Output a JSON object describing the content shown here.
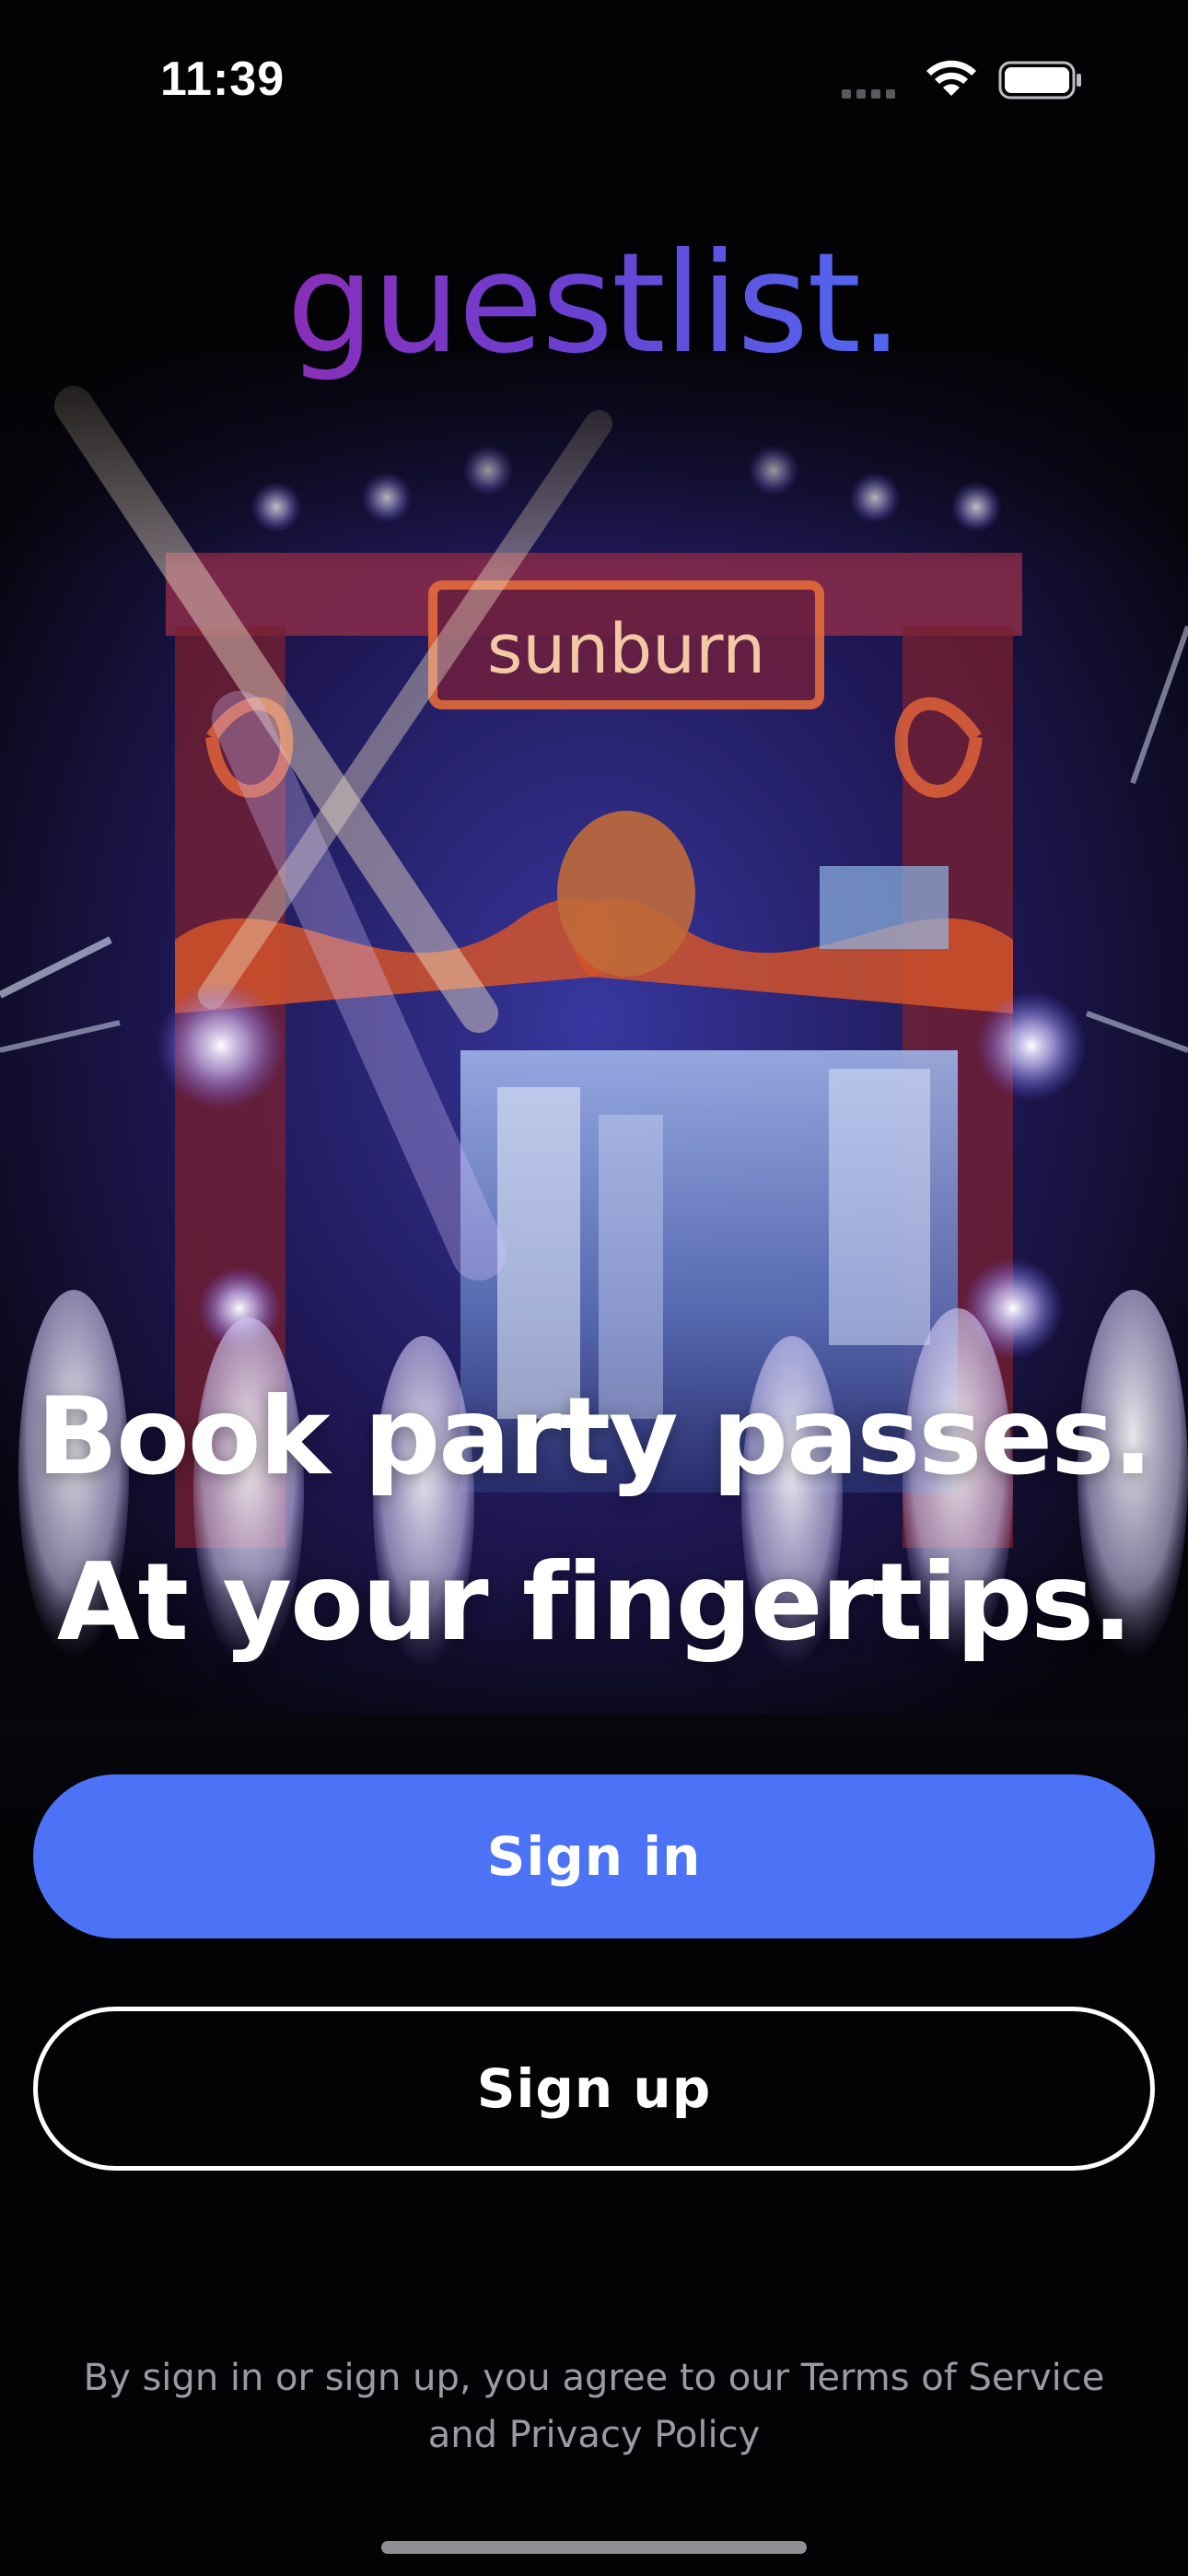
{
  "status_bar": {
    "time": "11:39",
    "icons": [
      "cellular-signal-icon",
      "wifi-icon",
      "battery-icon"
    ]
  },
  "brand": {
    "logo_text": "guestlist.",
    "gradient": [
      "#8a2eb8",
      "#4f6af2"
    ]
  },
  "hero": {
    "headline_line1": "Book party passes.",
    "headline_line2": "At your fingertips.",
    "stage_sign": "sunburn"
  },
  "actions": {
    "sign_in_label": "Sign in",
    "sign_up_label": "Sign up"
  },
  "legal": {
    "line1": "By sign in or sign up, you agree to our Terms of Service",
    "line2": "and Privacy Policy"
  },
  "colors": {
    "background": "#030305",
    "primary_button": "#4c72f5",
    "legal_text": "#9a9aa2"
  }
}
